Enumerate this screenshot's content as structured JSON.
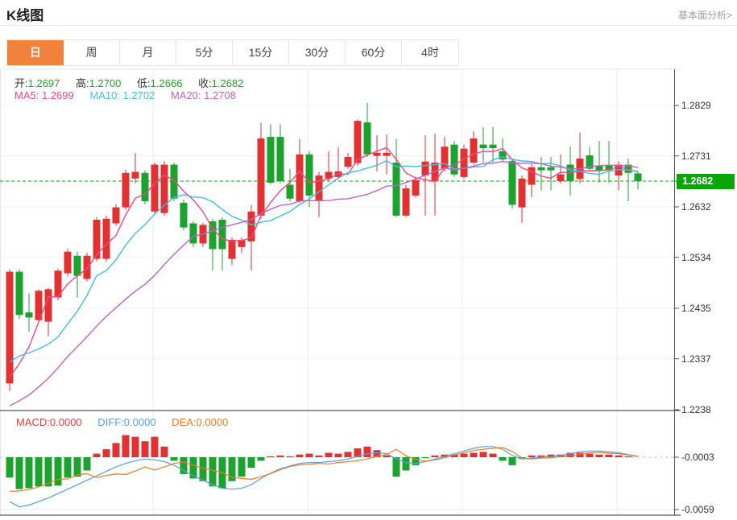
{
  "header": {
    "title": "K线图",
    "link_label": "基本面分析>"
  },
  "tabs": [
    {
      "label": "日",
      "active": true
    },
    {
      "label": "周",
      "active": false
    },
    {
      "label": "月",
      "active": false
    },
    {
      "label": "5分",
      "active": false
    },
    {
      "label": "15分",
      "active": false
    },
    {
      "label": "30分",
      "active": false
    },
    {
      "label": "60分",
      "active": false
    },
    {
      "label": "4时",
      "active": false
    }
  ],
  "ohlc_legend": {
    "open_label": "开:",
    "open_value": "1.2697",
    "high_label": "高:",
    "high_value": "1.2700",
    "low_label": "低:",
    "low_value": "1.2666",
    "close_label": "收:",
    "close_value": "1.2682"
  },
  "ma_legend": {
    "ma5_label": "MA5:",
    "ma5_value": "1.2699",
    "ma10_label": "MA10:",
    "ma10_value": "1.2702",
    "ma20_label": "MA20:",
    "ma20_value": "1.2708"
  },
  "macd_legend": {
    "macd_label": "MACD:",
    "macd_value": "0.0000",
    "diff_label": "DIFF:",
    "diff_value": "0.0000",
    "dea_label": "DEA:",
    "dea_value": "0.0000"
  },
  "price_axis": {
    "ticks": [
      "1.2829",
      "1.2731",
      "1.2632",
      "1.2534",
      "1.2435",
      "1.2337",
      "1.2238"
    ],
    "current_price_label": "1.2682"
  },
  "macd_axis": {
    "zero_line_label": "-0.0003",
    "bottom_label": "-0.0059"
  },
  "colors": {
    "up_red": "#e23131",
    "down_green": "#1ca32f",
    "ma5": "#f5487f",
    "ma10": "#44bce4",
    "ma20": "#bd64c6",
    "diff_blue": "#55a0e8",
    "dea_orange": "#f07c28",
    "current_line_green": "#0aa60a",
    "price_tag_bg": "#09a509",
    "tab_active_bg": "#f0823c",
    "ohlc_value_green": "#1fa81f",
    "macd_text_red": "#e84040",
    "zero_dash_blue": "#a8d4f0"
  },
  "chart_data": {
    "type": "candlestick",
    "title": "K线图",
    "panels": [
      "price",
      "macd"
    ],
    "price_ylim": [
      1.2238,
      1.2901
    ],
    "price_ticks": [
      1.2829,
      1.2731,
      1.2632,
      1.2534,
      1.2435,
      1.2337,
      1.2238
    ],
    "current_price": 1.2682,
    "last_ohlc": {
      "open": 1.2697,
      "high": 1.27,
      "low": 1.2666,
      "close": 1.2682
    },
    "ma_last_values": {
      "ma5": 1.2699,
      "ma10": 1.2702,
      "ma20": 1.2708
    },
    "candles": [
      [
        1.2289,
        1.2511,
        1.2274,
        1.2506
      ],
      [
        1.2506,
        1.2511,
        1.2414,
        1.2422
      ],
      [
        1.2427,
        1.2464,
        1.2389,
        1.2417
      ],
      [
        1.2412,
        1.2472,
        1.2406,
        1.2469
      ],
      [
        1.2409,
        1.2475,
        1.2381,
        1.2472
      ],
      [
        1.2456,
        1.2512,
        1.245,
        1.2508
      ],
      [
        1.2503,
        1.2551,
        1.2497,
        1.2545
      ],
      [
        1.2537,
        1.2545,
        1.2456,
        1.2498
      ],
      [
        1.2492,
        1.2543,
        1.2487,
        1.2537
      ],
      [
        1.2531,
        1.2612,
        1.2526,
        1.2607
      ],
      [
        1.2531,
        1.2615,
        1.2525,
        1.2609
      ],
      [
        1.26,
        1.2637,
        1.2595,
        1.2631
      ],
      [
        1.2631,
        1.2704,
        1.2626,
        1.2698
      ],
      [
        1.2687,
        1.2737,
        1.2678,
        1.27
      ],
      [
        1.2698,
        1.2703,
        1.2637,
        1.2643
      ],
      [
        1.2623,
        1.2718,
        1.2618,
        1.2714
      ],
      [
        1.262,
        1.2721,
        1.2615,
        1.2714
      ],
      [
        1.2714,
        1.2718,
        1.2643,
        1.2648
      ],
      [
        1.264,
        1.2646,
        1.2586,
        1.2592
      ],
      [
        1.26,
        1.2604,
        1.2554,
        1.2561
      ],
      [
        1.2561,
        1.2601,
        1.2554,
        1.2597
      ],
      [
        1.2604,
        1.2609,
        1.2508,
        1.255
      ],
      [
        1.2607,
        1.2612,
        1.2508,
        1.255
      ],
      [
        1.2531,
        1.2573,
        1.2519,
        1.2568
      ],
      [
        1.2554,
        1.2573,
        1.2542,
        1.2568
      ],
      [
        1.2565,
        1.2636,
        1.2508,
        1.2623
      ],
      [
        1.2615,
        1.2795,
        1.2609,
        1.2765
      ],
      [
        1.2768,
        1.2792,
        1.2675,
        1.2679
      ],
      [
        1.2768,
        1.2792,
        1.2678,
        1.2682
      ],
      [
        1.2675,
        1.2706,
        1.2643,
        1.2648
      ],
      [
        1.2643,
        1.2764,
        1.264,
        1.2734
      ],
      [
        1.2734,
        1.274,
        1.2632,
        1.2654
      ],
      [
        1.2643,
        1.27,
        1.2612,
        1.2693
      ],
      [
        1.2687,
        1.274,
        1.2682,
        1.27
      ],
      [
        1.269,
        1.2748,
        1.2686,
        1.2701
      ],
      [
        1.271,
        1.2737,
        1.2706,
        1.2729
      ],
      [
        1.2717,
        1.2802,
        1.2712,
        1.2799
      ],
      [
        1.2796,
        1.2834,
        1.2729,
        1.2734
      ],
      [
        1.2731,
        1.2771,
        1.2701,
        1.2737
      ],
      [
        1.2731,
        1.2773,
        1.2695,
        1.2737
      ],
      [
        1.2718,
        1.2764,
        1.2612,
        1.2615
      ],
      [
        1.2615,
        1.2675,
        1.2612,
        1.2668
      ],
      [
        1.2654,
        1.269,
        1.265,
        1.2684
      ],
      [
        1.2693,
        1.2771,
        1.2615,
        1.272
      ],
      [
        1.2682,
        1.2774,
        1.2615,
        1.2718
      ],
      [
        1.2706,
        1.2768,
        1.2701,
        1.2749
      ],
      [
        1.2753,
        1.276,
        1.269,
        1.2695
      ],
      [
        1.269,
        1.2753,
        1.2686,
        1.2745
      ],
      [
        1.2718,
        1.2779,
        1.2714,
        1.2765
      ],
      [
        1.2753,
        1.2787,
        1.2718,
        1.2746
      ],
      [
        1.2753,
        1.2787,
        1.2718,
        1.2746
      ],
      [
        1.274,
        1.2765,
        1.272,
        1.2724
      ],
      [
        1.2721,
        1.2726,
        1.2628,
        1.2636
      ],
      [
        1.2631,
        1.2693,
        1.2601,
        1.2687
      ],
      [
        1.2675,
        1.2715,
        1.2651,
        1.2709
      ],
      [
        1.2709,
        1.2729,
        1.2664,
        1.2703
      ],
      [
        1.2709,
        1.2729,
        1.2664,
        1.2703
      ],
      [
        1.2682,
        1.2734,
        1.2678,
        1.2695
      ],
      [
        1.2714,
        1.2749,
        1.2654,
        1.2682
      ],
      [
        1.2686,
        1.2776,
        1.2678,
        1.2726
      ],
      [
        1.2732,
        1.2748,
        1.2701,
        1.2706
      ],
      [
        1.2712,
        1.276,
        1.2679,
        1.2703
      ],
      [
        1.2712,
        1.276,
        1.2679,
        1.2703
      ],
      [
        1.2693,
        1.2721,
        1.2664,
        1.2714
      ],
      [
        1.2714,
        1.2726,
        1.2643,
        1.2698
      ],
      [
        1.2697,
        1.27,
        1.2666,
        1.2682
      ]
    ],
    "prior_closes_for_ma": [
      1.223,
      1.219,
      1.216,
      1.213,
      1.211,
      1.21,
      1.212,
      1.215,
      1.219,
      1.223,
      1.23,
      1.236,
      1.239,
      1.238,
      1.2368,
      1.229,
      1.2255,
      1.223,
      1.2225
    ],
    "ma_windows": [
      5,
      10,
      20
    ],
    "macd": {
      "display": {
        "macd": 0.0,
        "diff": 0.0,
        "dea": 0.0
      },
      "ylim": [
        -0.0064,
        0.0042
      ],
      "zero_tick": -0.0003,
      "bottom_tick": -0.0059,
      "hist": [
        -0.0023,
        -0.0036,
        -0.0035,
        -0.0033,
        -0.0033,
        -0.0032,
        -0.0023,
        -0.0022,
        -0.0015,
        0.0004,
        0.0009,
        0.0016,
        0.0025,
        0.0023,
        0.0018,
        0.0023,
        0.0012,
        -0.0004,
        -0.0019,
        -0.0024,
        -0.0027,
        -0.0033,
        -0.0035,
        -0.0027,
        -0.0022,
        -0.0012,
        -0.0004,
        0.0001,
        0.0002,
        0.0001,
        0.0003,
        0.0004,
        0.0002,
        0.0005,
        0.0004,
        0.0006,
        0.001,
        0.0012,
        0.0008,
        0.0002,
        -0.0022,
        -0.0015,
        -0.0009,
        -0.0001,
        0.0002,
        0.0003,
        0.0003,
        0.0004,
        0.0005,
        0.0006,
        0.0004,
        -0.0004,
        -0.0009,
        -0.0002,
        0.0002,
        0.0002,
        0.0003,
        0.0003,
        0.0005,
        0.0005,
        0.0004,
        0.0003,
        0.0003,
        0.0002,
        0.0001,
        0.0
      ],
      "diff": [
        -0.005,
        -0.0056,
        -0.0054,
        -0.005,
        -0.0046,
        -0.0041,
        -0.0036,
        -0.0031,
        -0.0026,
        -0.0021,
        -0.0016,
        -0.0011,
        -0.0007,
        -0.0004,
        -0.0002,
        -0.0003,
        -0.0005,
        -0.0009,
        -0.0015,
        -0.0021,
        -0.0026,
        -0.0031,
        -0.0035,
        -0.0036,
        -0.0035,
        -0.0031,
        -0.0024,
        -0.0018,
        -0.0013,
        -0.001,
        -0.0007,
        -0.0006,
        -0.0006,
        -0.0005,
        -0.0004,
        -0.0002,
        0.0001,
        0.0004,
        0.0005,
        0.0004,
        -0.0002,
        -0.0006,
        -0.0007,
        -0.0005,
        -0.0002,
        0.0001,
        0.0004,
        0.0007,
        0.001,
        0.0012,
        0.0012,
        0.0009,
        0.0002,
        -0.0002,
        -0.0001,
        0.0,
        0.0001,
        0.0002,
        0.0004,
        0.0006,
        0.0007,
        0.0007,
        0.0006,
        0.0005,
        0.0003,
        0.0001
      ]
    },
    "legend_position": "top-left",
    "grid": true
  }
}
